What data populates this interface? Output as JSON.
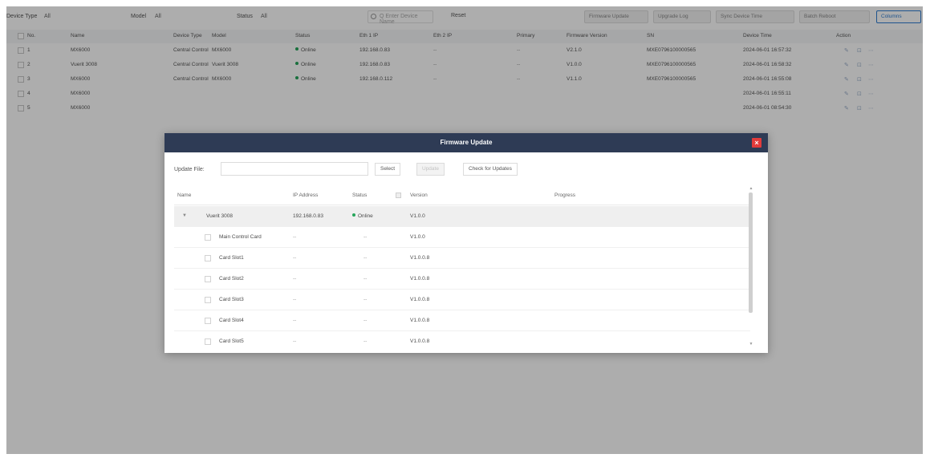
{
  "filters": {
    "device_type_label": "Device Type",
    "device_type_value": "All",
    "model_label": "Model",
    "model_value": "All",
    "status_label": "Status",
    "status_value": "All",
    "search_placeholder": "Q Enter Device Name",
    "reset_label": "Reset",
    "buttons": [
      "Firmware Update",
      "Upgrade Log",
      "Sync Device Time",
      "Batch Reboot",
      "Columns"
    ]
  },
  "device_table": {
    "columns": [
      "No.",
      "Name",
      "Device Type",
      "Model",
      "Status",
      "Eth 1 IP",
      "Eth 2 IP",
      "Primary",
      "Firmware Version",
      "SN",
      "Device Time",
      "Action"
    ],
    "rows": [
      {
        "no": "1",
        "name": "MX6000",
        "type": "Central Control",
        "model": "MX6000",
        "status": "Online",
        "eth1": "192.168.0.83",
        "eth2": "--",
        "primary": "--",
        "fw": "V2.1.0",
        "sn": "MXE0796100000565",
        "time": "2024-06-01 16:57:32"
      },
      {
        "no": "2",
        "name": "Vuerit 3008",
        "type": "Central Control",
        "model": "Vuerit 3008",
        "status": "Online",
        "eth1": "192.168.0.83",
        "eth2": "--",
        "primary": "--",
        "fw": "V1.0.0",
        "sn": "MXE0796100000565",
        "time": "2024-06-01 16:58:32"
      },
      {
        "no": "3",
        "name": "MX6000",
        "type": "Central Control",
        "model": "MX6000",
        "status": "Online",
        "eth1": "192.168.0.112",
        "eth2": "--",
        "primary": "--",
        "fw": "V1.1.0",
        "sn": "MXE0796100000565",
        "time": "2024-06-01 16:55:08"
      },
      {
        "no": "4",
        "name": "MX6000",
        "type": "",
        "model": "",
        "status": "",
        "eth1": "",
        "eth2": "",
        "primary": "",
        "fw": "",
        "sn": "",
        "time": "2024-06-01 16:55:11"
      },
      {
        "no": "5",
        "name": "MX6000",
        "type": "",
        "model": "",
        "status": "",
        "eth1": "",
        "eth2": "",
        "primary": "",
        "fw": "",
        "sn": "",
        "time": "2024-06-01 08:54:30"
      }
    ]
  },
  "modal": {
    "title": "Firmware Update",
    "close_symbol": "×",
    "update_file_label": "Update File:",
    "update_file_value": "",
    "select_label": "Select",
    "update_label": "Update",
    "check_label": "Check for Updates",
    "columns": [
      "Name",
      "IP Address",
      "Status",
      "Version",
      "Progress"
    ],
    "rows": [
      {
        "name": "Vuerit 3008",
        "ip": "192.168.0.83",
        "status": "Online",
        "version": "V1.0.0"
      },
      {
        "name": "Main Control Card",
        "ip": "--",
        "status": "--",
        "version": "V1.0.0"
      },
      {
        "name": "Card Slot1",
        "ip": "--",
        "status": "--",
        "version": "V1.0.0.8"
      },
      {
        "name": "Card Slot2",
        "ip": "--",
        "status": "--",
        "version": "V1.0.0.8"
      },
      {
        "name": "Card Slot3",
        "ip": "--",
        "status": "--",
        "version": "V1.0.0.8"
      },
      {
        "name": "Card Slot4",
        "ip": "--",
        "status": "--",
        "version": "V1.0.0.8"
      },
      {
        "name": "Card Slot5",
        "ip": "--",
        "status": "--",
        "version": "V1.0.0.8"
      }
    ]
  },
  "colors": {
    "online": "#26a65b",
    "header": "#2e3b55",
    "close": "#e23b3b"
  }
}
